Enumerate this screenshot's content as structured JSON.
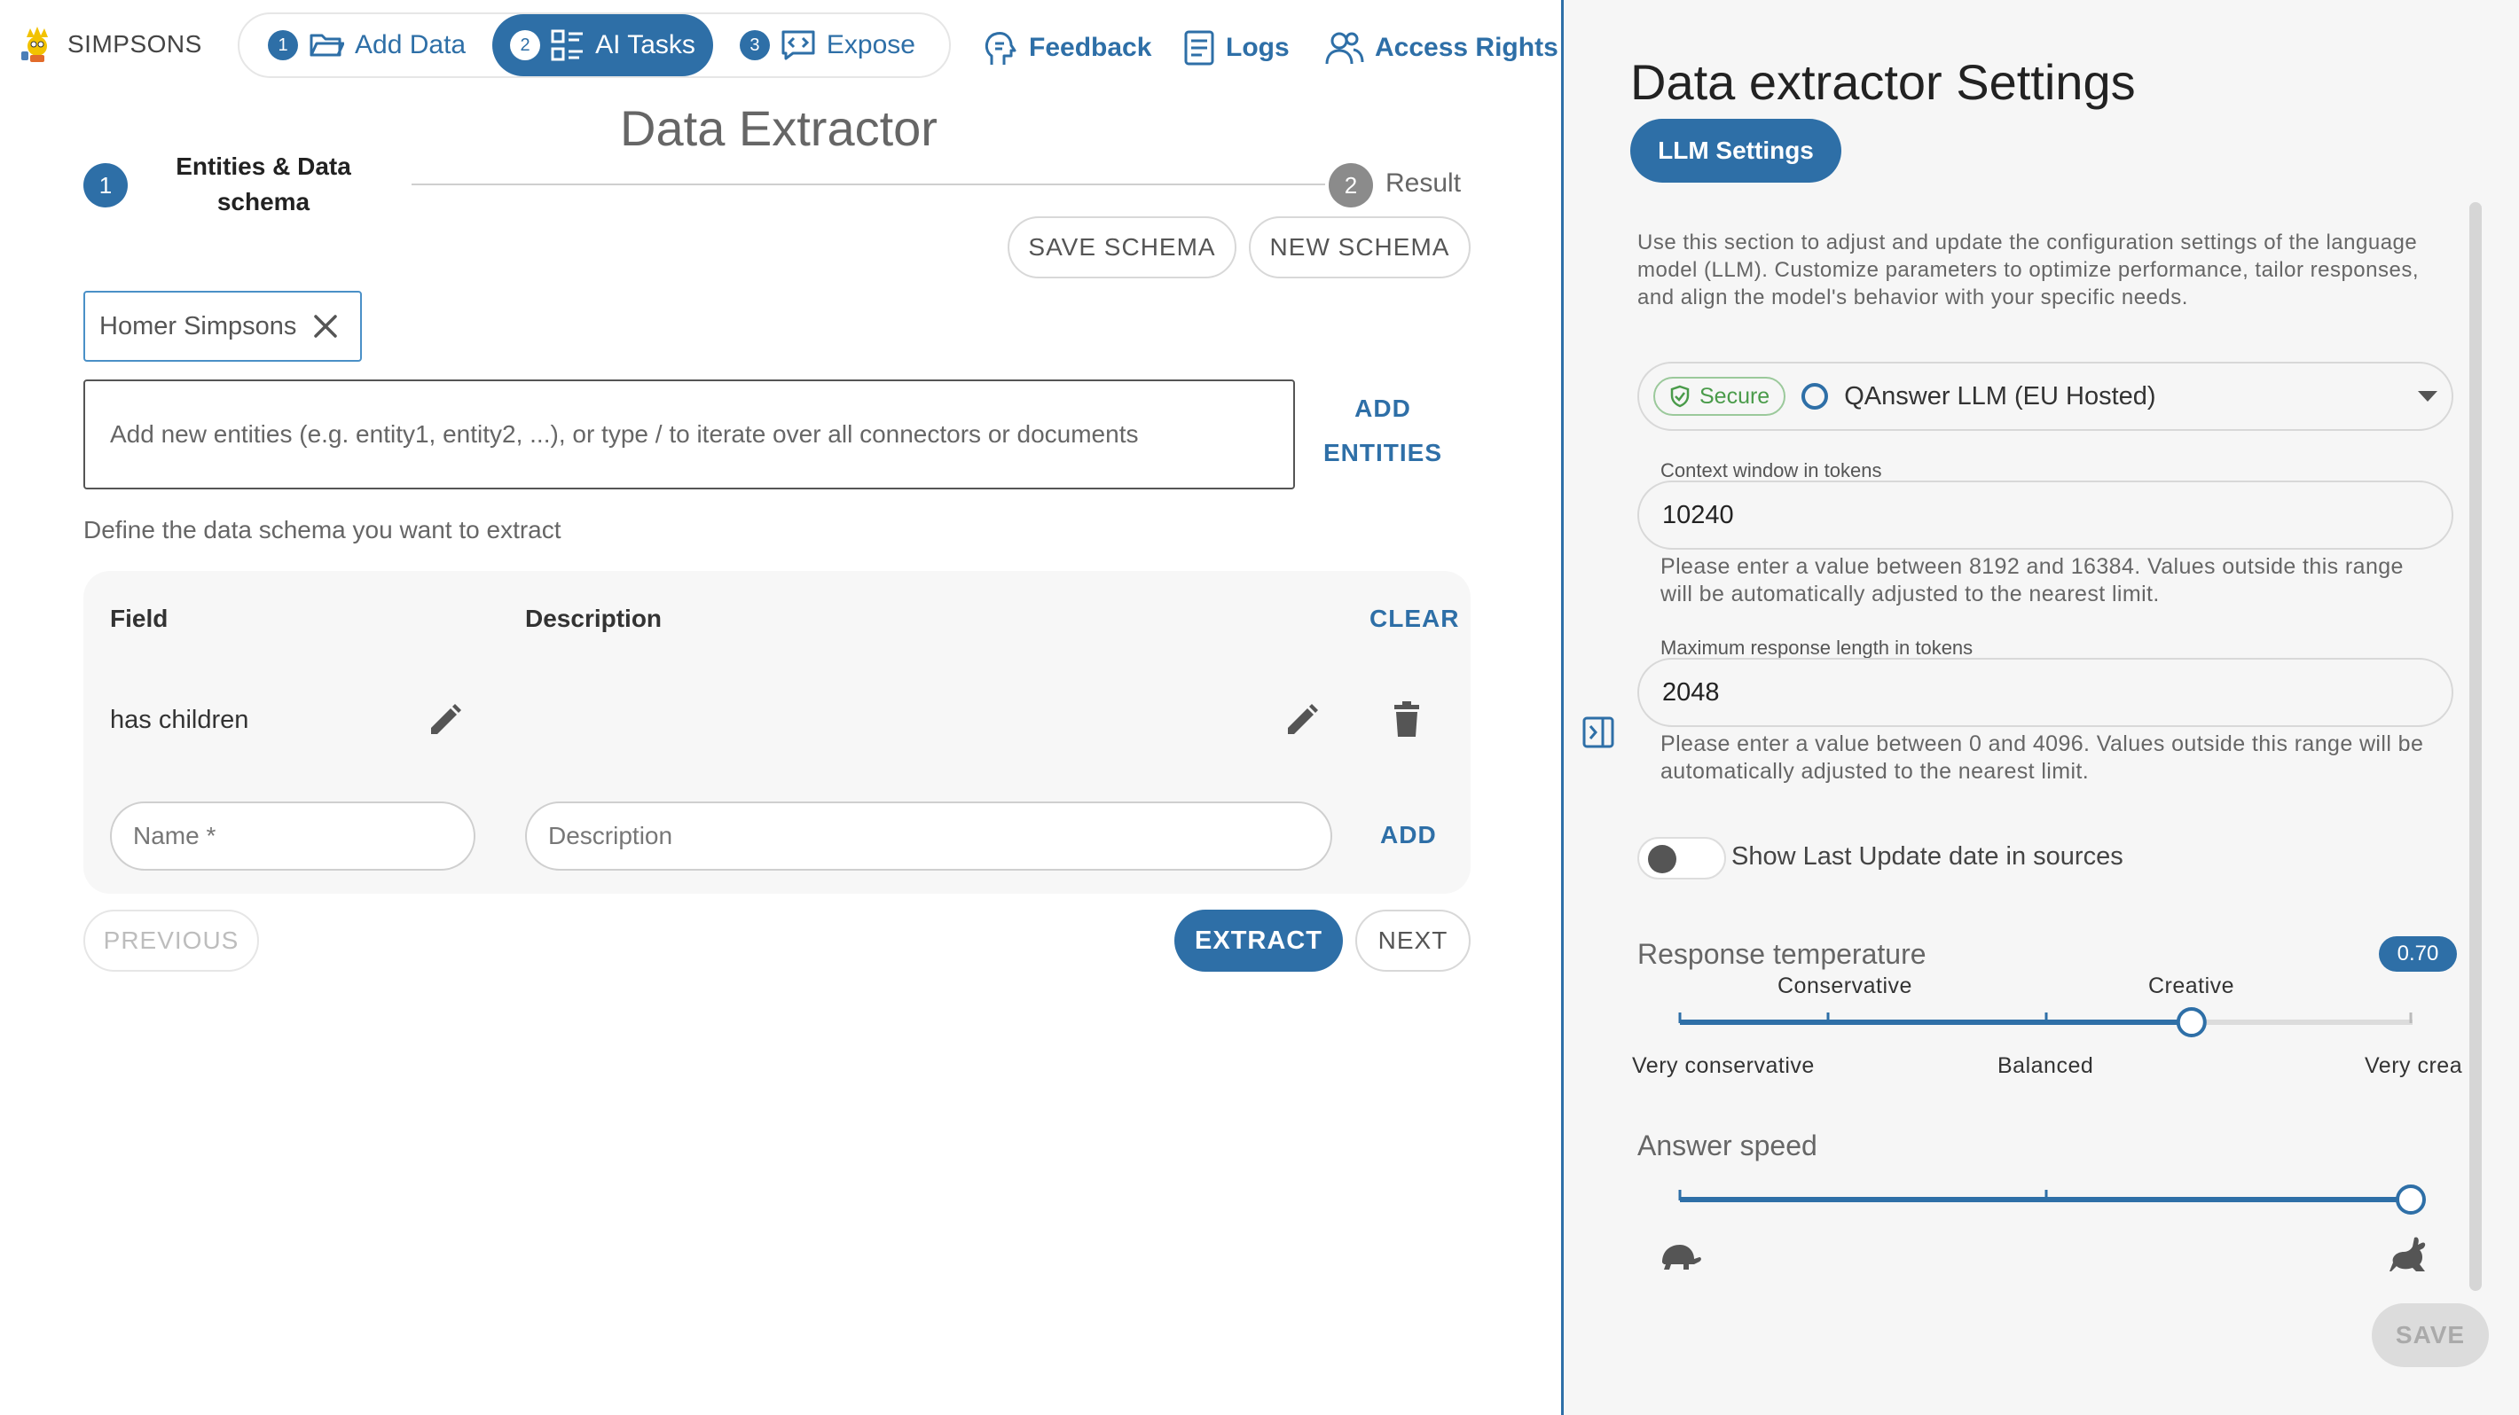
{
  "brand": {
    "name": "SIMPSONS"
  },
  "nav": {
    "steps": [
      {
        "num": "1",
        "label": "Add Data"
      },
      {
        "num": "2",
        "label": "AI Tasks"
      },
      {
        "num": "3",
        "label": "Expose"
      }
    ],
    "links": {
      "feedback": "Feedback",
      "logs": "Logs",
      "access": "Access Rights"
    }
  },
  "main": {
    "title": "Data Extractor",
    "stepper": {
      "step1_num": "1",
      "step1_line1": "Entities & Data",
      "step1_line2": "schema",
      "step2_num": "2",
      "step2_label": "Result"
    },
    "buttons": {
      "save_schema": "SAVE SCHEMA",
      "new_schema": "NEW SCHEMA"
    },
    "entity_chip": "Homer Simpsons",
    "entity_input_placeholder": "Add new entities (e.g. entity1, entity2, ...), or type / to iterate over all connectors or documents",
    "add_entities_line1": "ADD",
    "add_entities_line2": "ENTITIES",
    "schema_hint": "Define the data schema you want to extract",
    "table": {
      "col_field": "Field",
      "col_description": "Description",
      "clear": "CLEAR",
      "rows": [
        {
          "field": "has children",
          "description": ""
        }
      ],
      "name_placeholder": "Name *",
      "description_placeholder": "Description",
      "add": "ADD"
    },
    "footer": {
      "previous": "PREVIOUS",
      "extract": "EXTRACT",
      "next": "NEXT"
    }
  },
  "panel": {
    "title": "Data extractor Settings",
    "tab": "LLM Settings",
    "description": "Use this section to adjust and update the configuration settings of the language model (LLM). Customize parameters to optimize performance, tailor responses, and align the model's behavior with your specific needs.",
    "model": {
      "badge": "Secure",
      "name": "QAnswer LLM (EU Hosted)"
    },
    "context": {
      "label": "Context window in tokens",
      "value": "10240",
      "help": "Please enter a value between 8192 and 16384. Values outside this range will be automatically adjusted to the nearest limit."
    },
    "max_response": {
      "label": "Maximum response length in tokens",
      "value": "2048",
      "help": "Please enter a value between 0 and 4096. Values outside this range will be automatically adjusted to the nearest limit."
    },
    "toggle": {
      "label": "Show Last Update date in sources",
      "on": false
    },
    "temperature": {
      "label": "Response temperature",
      "value": 0.7,
      "display": "0.70",
      "marks_top": [
        "Conservative",
        "Creative"
      ],
      "marks_bottom": [
        "Very conservative",
        "Balanced",
        "Very crea"
      ]
    },
    "speed": {
      "label": "Answer speed",
      "value": 1.0
    },
    "save": "SAVE"
  },
  "colors": {
    "accent": "#2e6fa7",
    "secure": "#4a9b4a"
  }
}
